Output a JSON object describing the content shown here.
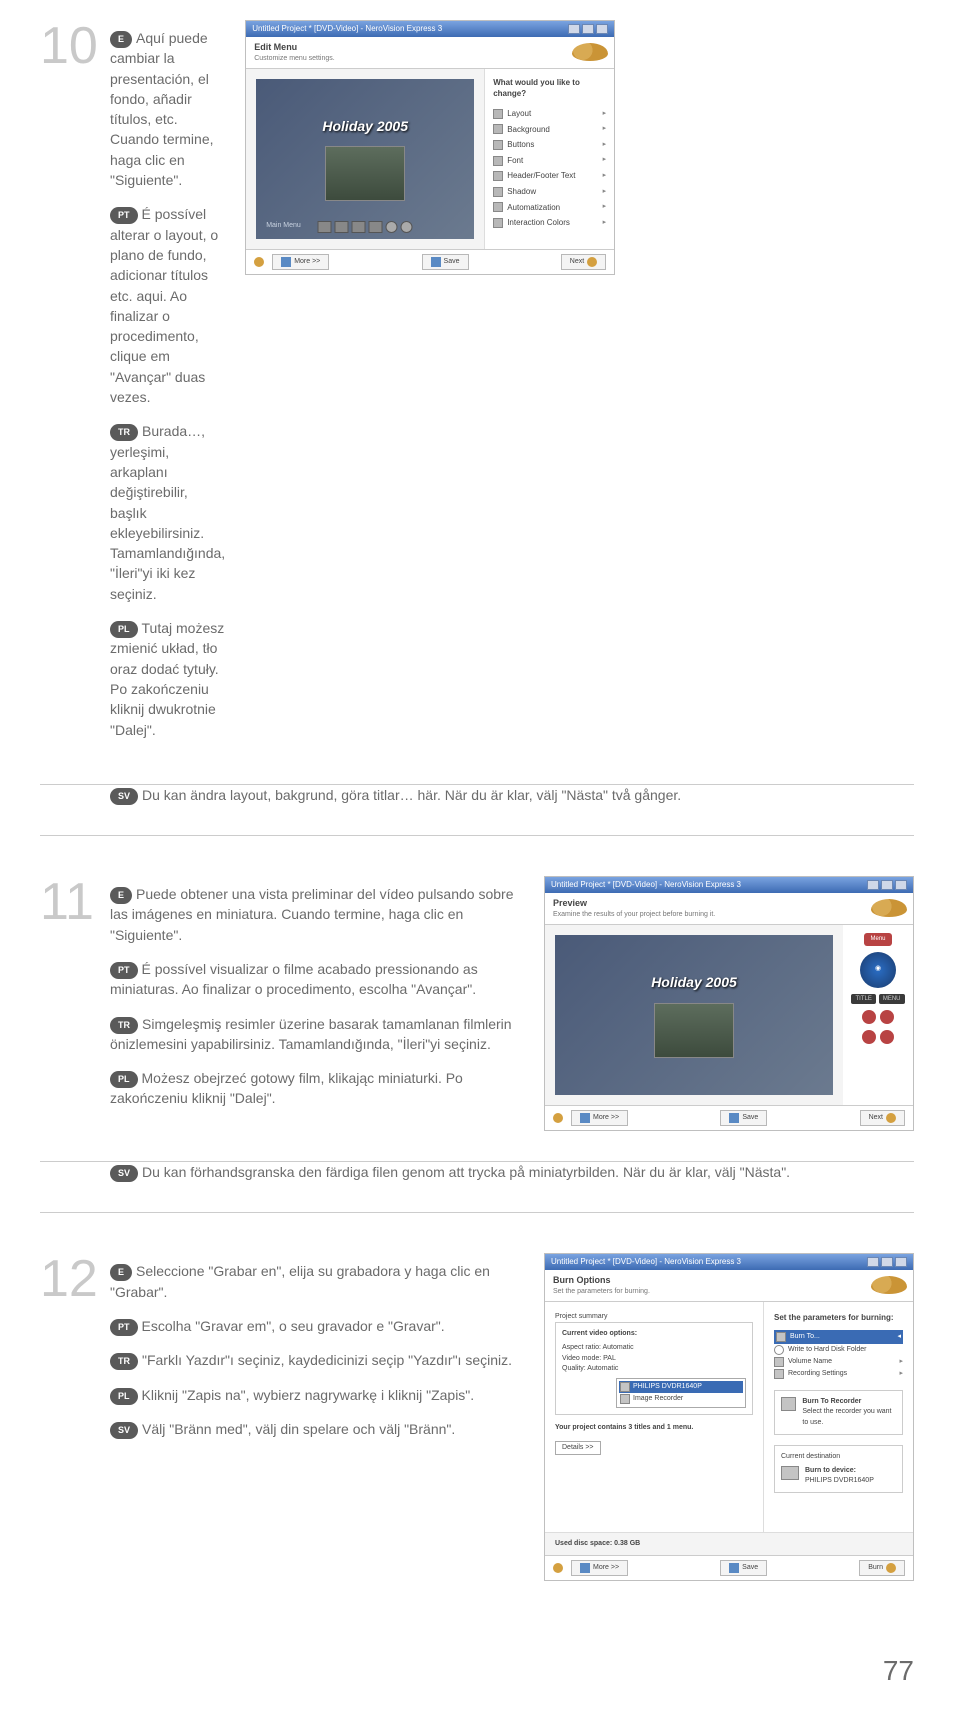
{
  "page_number": "77",
  "steps": [
    {
      "num": "10",
      "langs": [
        {
          "code": "E",
          "text": "Aquí puede cambiar la presentación, el fondo, añadir títulos, etc. Cuando termine, haga clic en \"Siguiente\"."
        },
        {
          "code": "PT",
          "text": "É possível alterar o layout, o plano de fundo, adicionar títulos etc. aqui. Ao finalizar o procedimento, clique em \"Avançar\" duas vezes."
        },
        {
          "code": "TR",
          "text": "Burada…, yerleşimi, arkaplanı değiştirebilir, başlık ekleyebilirsiniz. Tamamlandığında, \"İleri\"yi iki kez seçiniz."
        },
        {
          "code": "PL",
          "text": "Tutaj możesz zmienić układ, tło oraz dodać tytuły. Po zakończeniu kliknij dwukrotnie \"Dalej\"."
        }
      ],
      "full": {
        "code": "SV",
        "text": "Du kan ändra layout, bakgrund, göra titlar… här. När du är klar, välj \"Nästa\" två gånger."
      }
    },
    {
      "num": "11",
      "langs": [
        {
          "code": "E",
          "text": "Puede obtener una vista preliminar del vídeo pulsando sobre las imágenes en miniatura. Cuando termine, haga clic en \"Siguiente\"."
        },
        {
          "code": "PT",
          "text": "É possível visualizar o filme acabado pressionando as miniaturas. Ao finalizar o procedimento, escolha \"Avançar\"."
        },
        {
          "code": "TR",
          "text": "Simgeleşmiş resimler üzerine basarak tamamlanan filmlerin önizlemesini yapabilirsiniz. Tamamlandığında, \"İleri\"yi seçiniz."
        },
        {
          "code": "PL",
          "text": "Możesz obejrzeć gotowy film, klikając miniaturki. Po zakończeniu kliknij \"Dalej\"."
        }
      ],
      "full": {
        "code": "SV",
        "text": "Du kan förhandsgranska den färdiga filen genom att trycka på miniatyrbilden. När du är klar, välj \"Nästa\"."
      }
    },
    {
      "num": "12",
      "langs": [
        {
          "code": "E",
          "text": "Seleccione \"Grabar en\", elija su grabadora y haga clic en \"Grabar\"."
        },
        {
          "code": "PT",
          "text": "Escolha \"Gravar em\", o seu gravador e \"Gravar\"."
        },
        {
          "code": "TR",
          "text": "\"Farklı Yazdır\"ı seçiniz, kaydedicinizi seçip \"Yazdır\"ı seçiniz."
        },
        {
          "code": "PL",
          "text": "Kliknij \"Zapis na\", wybierz nagrywarkę i kliknij \"Zapis\"."
        },
        {
          "code": "SV",
          "text": "Välj \"Bränn med\", välj din spelare och välj \"Bränn\"."
        }
      ]
    }
  ],
  "shot10": {
    "title": "Untitled Project * [DVD-Video] - NeroVision Express 3",
    "header_title": "Edit Menu",
    "header_sub": "Customize menu settings.",
    "holiday": "Holiday 2005",
    "main_menu": "Main Menu",
    "side_title": "What would you like to change?",
    "side_items": [
      "Layout",
      "Background",
      "Buttons",
      "Font",
      "Header/Footer Text",
      "Shadow",
      "Automatization",
      "Interaction Colors"
    ],
    "more": "More >>",
    "save": "Save",
    "next": "Next"
  },
  "shot11": {
    "title": "Untitled Project * [DVD-Video] - NeroVision Express 3",
    "header_title": "Preview",
    "header_sub": "Examine the results of your project before burning it.",
    "holiday": "Holiday 2005",
    "menu": "Menu",
    "more": "More >>",
    "save": "Save",
    "next": "Next"
  },
  "shot12": {
    "title": "Untitled Project * [DVD-Video] - NeroVision Express 3",
    "header_title": "Burn Options",
    "header_sub": "Set the parameters for burning.",
    "proj_summary": "Project summary",
    "cvo": "Current video options:",
    "aspect": "Aspect ratio: Automatic",
    "vmode": "Video mode: PAL",
    "quality": "Quality: Automatic",
    "contains": "Your project contains 3 titles and 1 menu.",
    "details": "Details >>",
    "device1": "PHILIPS DVDR1640P",
    "device2": "Image Recorder",
    "used": "Used disc space: 0.38 GB",
    "side_title": "Set the parameters for burning:",
    "burn_to": "Burn To...",
    "whdf": "Write to Hard Disk Folder",
    "vol_name": "Volume Name",
    "rec_set": "Recording Settings",
    "btr": "Burn To Recorder",
    "sel_rec": "Select the recorder you want to use.",
    "cur_dest": "Current destination",
    "btd": "Burn to device:",
    "btd_dev": "PHILIPS DVDR1640P",
    "more": "More >>",
    "save": "Save",
    "burn": "Burn"
  }
}
